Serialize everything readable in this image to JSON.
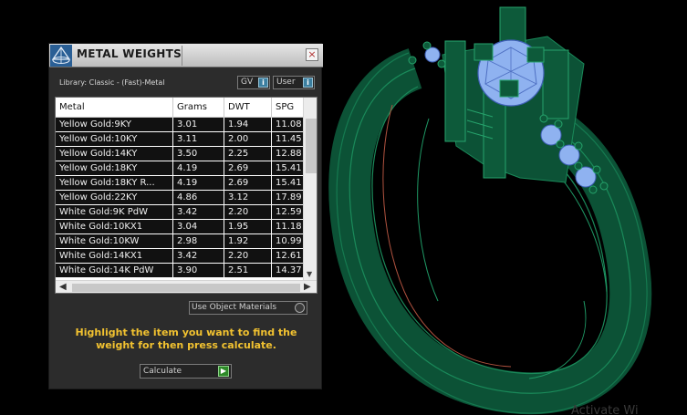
{
  "panel": {
    "title": "METAL WEIGHTS",
    "close_label": "×",
    "library_label": "Library: Classic - (Fast)-Metal",
    "gv_select": "GV",
    "user_select": "User",
    "dropdown_button_label": "i",
    "columns": [
      "Metal",
      "Grams",
      "DWT",
      "SPG"
    ],
    "rows": [
      [
        "Yellow Gold:9KY",
        "3.01",
        "1.94",
        "11.08"
      ],
      [
        "Yellow Gold:10KY",
        "3.11",
        "2.00",
        "11.45"
      ],
      [
        "Yellow Gold:14KY",
        "3.50",
        "2.25",
        "12.88"
      ],
      [
        "Yellow Gold:18KY",
        "4.19",
        "2.69",
        "15.41"
      ],
      [
        "Yellow Gold:18KY R...",
        "4.19",
        "2.69",
        "15.41"
      ],
      [
        "Yellow Gold:22KY",
        "4.86",
        "3.12",
        "17.89"
      ],
      [
        "White Gold:9K PdW",
        "3.42",
        "2.20",
        "12.59"
      ],
      [
        "White Gold:10KX1",
        "3.04",
        "1.95",
        "11.18"
      ],
      [
        "White Gold:10KW",
        "2.98",
        "1.92",
        "10.99"
      ],
      [
        "White Gold:14KX1",
        "3.42",
        "2.20",
        "12.61"
      ],
      [
        "White Gold:14K PdW",
        "3.90",
        "2.51",
        "14.37"
      ]
    ],
    "use_object_materials_label": "Use Object Materials",
    "instruction": "Highlight the item you want to find the weight for then press calculate.",
    "calculate_label": "Calculate",
    "calculate_arrow": "▶"
  },
  "viewport": {
    "watermark": "Activate Wi"
  },
  "colors": {
    "ring_green": "#0d5a3a",
    "gem_blue": "#8fb2f0",
    "instruction_yellow": "#f2c230"
  }
}
